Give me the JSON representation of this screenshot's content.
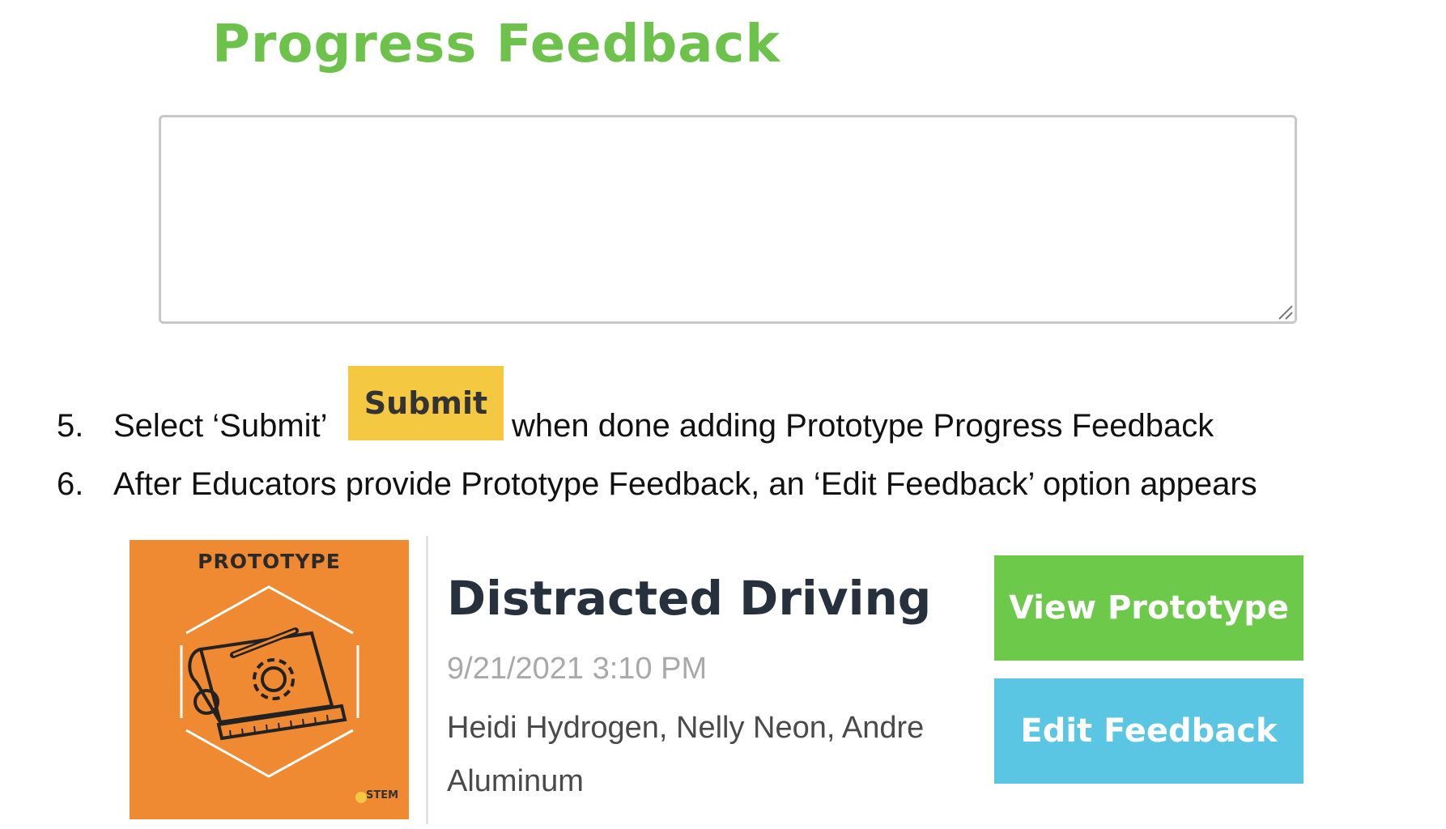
{
  "heading": "Progress Feedback",
  "feedback_input": {
    "value": "",
    "placeholder": ""
  },
  "steps": [
    {
      "number": "5.",
      "before": "Select ‘Submit’",
      "button_label": "Submit",
      "after": "when done adding Prototype Progress Feedback"
    },
    {
      "number": "6.",
      "text": "After Educators provide Prototype Feedback, an ‘Edit Feedback’ option appears"
    }
  ],
  "card": {
    "badge": "PROTOTYPE",
    "logo_text": "STEM",
    "title": "Distracted Driving",
    "date": "9/21/2021 3:10 PM",
    "members": "Heidi Hydrogen, Nelly Neon, Andre Aluminum",
    "view_button": "View Prototype",
    "edit_button": "Edit Feedback"
  },
  "colors": {
    "heading_green": "#6cc24a",
    "submit_yellow": "#f5c842",
    "card_orange": "#ef8a32",
    "view_green": "#6cc94a",
    "edit_blue": "#5bc6e4"
  }
}
